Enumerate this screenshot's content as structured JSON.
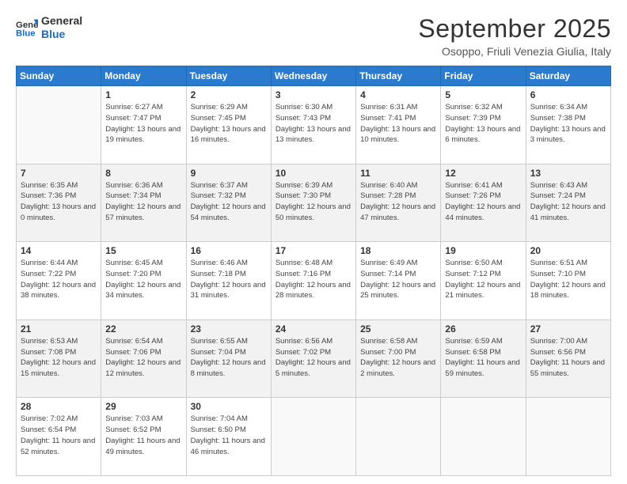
{
  "header": {
    "logo_line1": "General",
    "logo_line2": "Blue",
    "month": "September 2025",
    "location": "Osoppo, Friuli Venezia Giulia, Italy"
  },
  "weekdays": [
    "Sunday",
    "Monday",
    "Tuesday",
    "Wednesday",
    "Thursday",
    "Friday",
    "Saturday"
  ],
  "weeks": [
    {
      "shaded": false,
      "days": [
        {
          "num": "",
          "sunrise": "",
          "sunset": "",
          "daylight": ""
        },
        {
          "num": "1",
          "sunrise": "Sunrise: 6:27 AM",
          "sunset": "Sunset: 7:47 PM",
          "daylight": "Daylight: 13 hours and 19 minutes."
        },
        {
          "num": "2",
          "sunrise": "Sunrise: 6:29 AM",
          "sunset": "Sunset: 7:45 PM",
          "daylight": "Daylight: 13 hours and 16 minutes."
        },
        {
          "num": "3",
          "sunrise": "Sunrise: 6:30 AM",
          "sunset": "Sunset: 7:43 PM",
          "daylight": "Daylight: 13 hours and 13 minutes."
        },
        {
          "num": "4",
          "sunrise": "Sunrise: 6:31 AM",
          "sunset": "Sunset: 7:41 PM",
          "daylight": "Daylight: 13 hours and 10 minutes."
        },
        {
          "num": "5",
          "sunrise": "Sunrise: 6:32 AM",
          "sunset": "Sunset: 7:39 PM",
          "daylight": "Daylight: 13 hours and 6 minutes."
        },
        {
          "num": "6",
          "sunrise": "Sunrise: 6:34 AM",
          "sunset": "Sunset: 7:38 PM",
          "daylight": "Daylight: 13 hours and 3 minutes."
        }
      ]
    },
    {
      "shaded": true,
      "days": [
        {
          "num": "7",
          "sunrise": "Sunrise: 6:35 AM",
          "sunset": "Sunset: 7:36 PM",
          "daylight": "Daylight: 13 hours and 0 minutes."
        },
        {
          "num": "8",
          "sunrise": "Sunrise: 6:36 AM",
          "sunset": "Sunset: 7:34 PM",
          "daylight": "Daylight: 12 hours and 57 minutes."
        },
        {
          "num": "9",
          "sunrise": "Sunrise: 6:37 AM",
          "sunset": "Sunset: 7:32 PM",
          "daylight": "Daylight: 12 hours and 54 minutes."
        },
        {
          "num": "10",
          "sunrise": "Sunrise: 6:39 AM",
          "sunset": "Sunset: 7:30 PM",
          "daylight": "Daylight: 12 hours and 50 minutes."
        },
        {
          "num": "11",
          "sunrise": "Sunrise: 6:40 AM",
          "sunset": "Sunset: 7:28 PM",
          "daylight": "Daylight: 12 hours and 47 minutes."
        },
        {
          "num": "12",
          "sunrise": "Sunrise: 6:41 AM",
          "sunset": "Sunset: 7:26 PM",
          "daylight": "Daylight: 12 hours and 44 minutes."
        },
        {
          "num": "13",
          "sunrise": "Sunrise: 6:43 AM",
          "sunset": "Sunset: 7:24 PM",
          "daylight": "Daylight: 12 hours and 41 minutes."
        }
      ]
    },
    {
      "shaded": false,
      "days": [
        {
          "num": "14",
          "sunrise": "Sunrise: 6:44 AM",
          "sunset": "Sunset: 7:22 PM",
          "daylight": "Daylight: 12 hours and 38 minutes."
        },
        {
          "num": "15",
          "sunrise": "Sunrise: 6:45 AM",
          "sunset": "Sunset: 7:20 PM",
          "daylight": "Daylight: 12 hours and 34 minutes."
        },
        {
          "num": "16",
          "sunrise": "Sunrise: 6:46 AM",
          "sunset": "Sunset: 7:18 PM",
          "daylight": "Daylight: 12 hours and 31 minutes."
        },
        {
          "num": "17",
          "sunrise": "Sunrise: 6:48 AM",
          "sunset": "Sunset: 7:16 PM",
          "daylight": "Daylight: 12 hours and 28 minutes."
        },
        {
          "num": "18",
          "sunrise": "Sunrise: 6:49 AM",
          "sunset": "Sunset: 7:14 PM",
          "daylight": "Daylight: 12 hours and 25 minutes."
        },
        {
          "num": "19",
          "sunrise": "Sunrise: 6:50 AM",
          "sunset": "Sunset: 7:12 PM",
          "daylight": "Daylight: 12 hours and 21 minutes."
        },
        {
          "num": "20",
          "sunrise": "Sunrise: 6:51 AM",
          "sunset": "Sunset: 7:10 PM",
          "daylight": "Daylight: 12 hours and 18 minutes."
        }
      ]
    },
    {
      "shaded": true,
      "days": [
        {
          "num": "21",
          "sunrise": "Sunrise: 6:53 AM",
          "sunset": "Sunset: 7:08 PM",
          "daylight": "Daylight: 12 hours and 15 minutes."
        },
        {
          "num": "22",
          "sunrise": "Sunrise: 6:54 AM",
          "sunset": "Sunset: 7:06 PM",
          "daylight": "Daylight: 12 hours and 12 minutes."
        },
        {
          "num": "23",
          "sunrise": "Sunrise: 6:55 AM",
          "sunset": "Sunset: 7:04 PM",
          "daylight": "Daylight: 12 hours and 8 minutes."
        },
        {
          "num": "24",
          "sunrise": "Sunrise: 6:56 AM",
          "sunset": "Sunset: 7:02 PM",
          "daylight": "Daylight: 12 hours and 5 minutes."
        },
        {
          "num": "25",
          "sunrise": "Sunrise: 6:58 AM",
          "sunset": "Sunset: 7:00 PM",
          "daylight": "Daylight: 12 hours and 2 minutes."
        },
        {
          "num": "26",
          "sunrise": "Sunrise: 6:59 AM",
          "sunset": "Sunset: 6:58 PM",
          "daylight": "Daylight: 11 hours and 59 minutes."
        },
        {
          "num": "27",
          "sunrise": "Sunrise: 7:00 AM",
          "sunset": "Sunset: 6:56 PM",
          "daylight": "Daylight: 11 hours and 55 minutes."
        }
      ]
    },
    {
      "shaded": false,
      "days": [
        {
          "num": "28",
          "sunrise": "Sunrise: 7:02 AM",
          "sunset": "Sunset: 6:54 PM",
          "daylight": "Daylight: 11 hours and 52 minutes."
        },
        {
          "num": "29",
          "sunrise": "Sunrise: 7:03 AM",
          "sunset": "Sunset: 6:52 PM",
          "daylight": "Daylight: 11 hours and 49 minutes."
        },
        {
          "num": "30",
          "sunrise": "Sunrise: 7:04 AM",
          "sunset": "Sunset: 6:50 PM",
          "daylight": "Daylight: 11 hours and 46 minutes."
        },
        {
          "num": "",
          "sunrise": "",
          "sunset": "",
          "daylight": ""
        },
        {
          "num": "",
          "sunrise": "",
          "sunset": "",
          "daylight": ""
        },
        {
          "num": "",
          "sunrise": "",
          "sunset": "",
          "daylight": ""
        },
        {
          "num": "",
          "sunrise": "",
          "sunset": "",
          "daylight": ""
        }
      ]
    }
  ]
}
